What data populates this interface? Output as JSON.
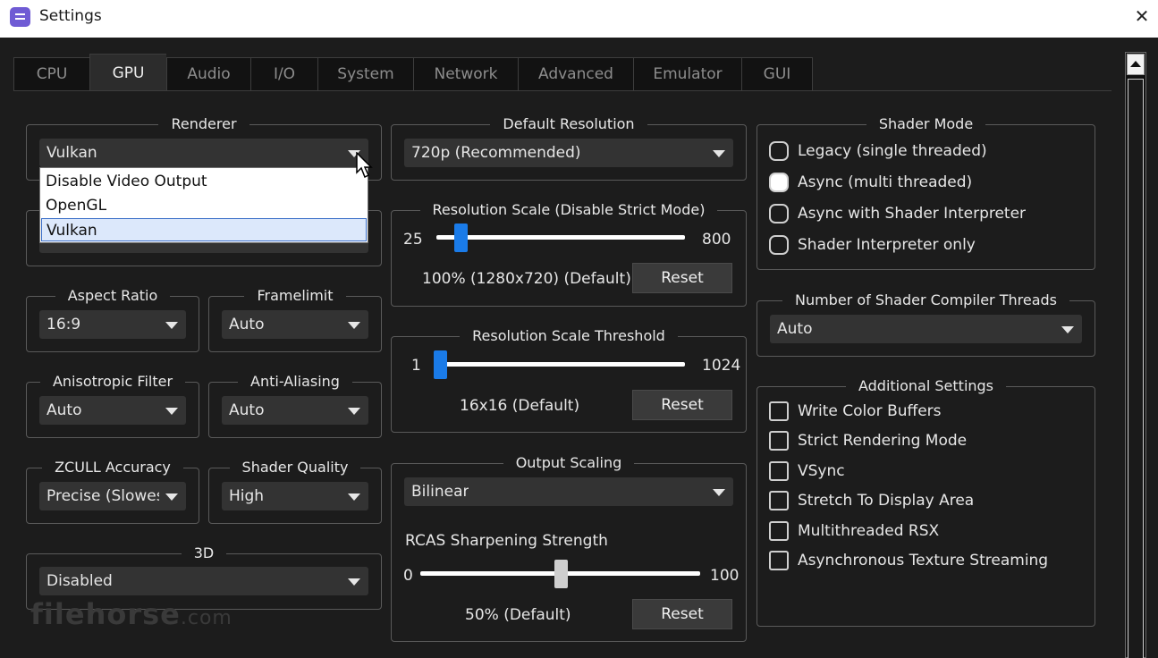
{
  "window": {
    "title": "Settings",
    "close_glyph": "✕"
  },
  "tabs": [
    {
      "label": "CPU",
      "active": false
    },
    {
      "label": "GPU",
      "active": true
    },
    {
      "label": "Audio",
      "active": false
    },
    {
      "label": "I/O",
      "active": false
    },
    {
      "label": "System",
      "active": false
    },
    {
      "label": "Network",
      "active": false
    },
    {
      "label": "Advanced",
      "active": false
    },
    {
      "label": "Emulator",
      "active": false
    },
    {
      "label": "GUI",
      "active": false
    }
  ],
  "renderer": {
    "title": "Renderer",
    "value": "Vulkan",
    "options": [
      "Disable Video Output",
      "OpenGL",
      "Vulkan"
    ],
    "selected_option": "Vulkan"
  },
  "aspect_ratio": {
    "title": "Aspect Ratio",
    "value": "16:9"
  },
  "framelimit": {
    "title": "Framelimit",
    "value": "Auto"
  },
  "anisotropic_filter": {
    "title": "Anisotropic Filter",
    "value": "Auto"
  },
  "anti_aliasing": {
    "title": "Anti-Aliasing",
    "value": "Auto"
  },
  "zcull_accuracy": {
    "title": "ZCULL Accuracy",
    "value": "Precise (Slowest)"
  },
  "shader_quality": {
    "title": "Shader Quality",
    "value": "High"
  },
  "three_d": {
    "title": "3D",
    "value": "Disabled"
  },
  "default_resolution": {
    "title": "Default Resolution",
    "value": "720p (Recommended)"
  },
  "resolution_scale": {
    "title": "Resolution Scale (Disable Strict Mode)",
    "min": "25",
    "max": "800",
    "value": 100,
    "status": "100% (1280x720) (Default)",
    "reset_label": "Reset"
  },
  "resolution_scale_threshold": {
    "title": "Resolution Scale Threshold",
    "min": "1",
    "max": "1024",
    "value": 16,
    "status": "16x16 (Default)",
    "reset_label": "Reset"
  },
  "output_scaling": {
    "title": "Output Scaling",
    "value": "Bilinear",
    "rcas_label": "RCAS Sharpening Strength",
    "min": "0",
    "max": "100",
    "value_pct": 50,
    "status": "50% (Default)",
    "reset_label": "Reset"
  },
  "shader_mode": {
    "title": "Shader Mode",
    "options": [
      {
        "label": "Legacy (single threaded)",
        "selected": false
      },
      {
        "label": "Async (multi threaded)",
        "selected": true
      },
      {
        "label": "Async with Shader Interpreter",
        "selected": false
      },
      {
        "label": "Shader Interpreter only",
        "selected": false
      }
    ]
  },
  "shader_compiler_threads": {
    "title": "Number of Shader Compiler Threads",
    "value": "Auto"
  },
  "additional_settings": {
    "title": "Additional Settings",
    "options": [
      {
        "label": "Write Color Buffers",
        "checked": false
      },
      {
        "label": "Strict Rendering Mode",
        "checked": false
      },
      {
        "label": "VSync",
        "checked": false
      },
      {
        "label": "Stretch To Display Area",
        "checked": false
      },
      {
        "label": "Multithreaded RSX",
        "checked": false
      },
      {
        "label": "Asynchronous Texture Streaming",
        "checked": false
      }
    ]
  },
  "watermark": {
    "text": "filehorse",
    "suffix": ".com"
  }
}
